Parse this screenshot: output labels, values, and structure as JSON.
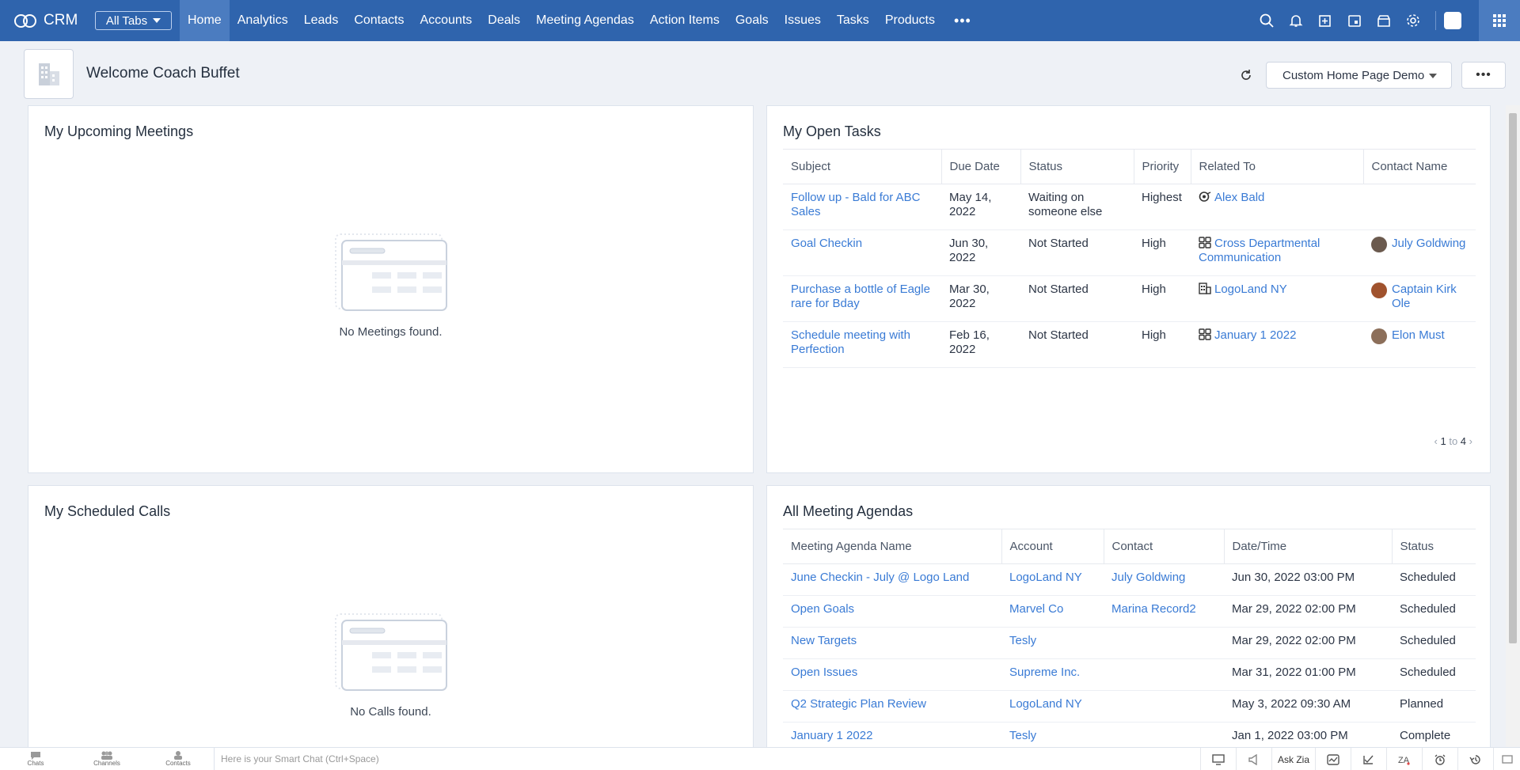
{
  "nav": {
    "brand": "CRM",
    "all_tabs": "All Tabs",
    "links": [
      "Home",
      "Analytics",
      "Leads",
      "Contacts",
      "Accounts",
      "Deals",
      "Meeting Agendas",
      "Action Items",
      "Goals",
      "Issues",
      "Tasks",
      "Products"
    ],
    "active": "Home",
    "more": "•••"
  },
  "header": {
    "welcome": "Welcome Coach Buffet",
    "layout_select": "Custom Home Page Demo",
    "more": "•••"
  },
  "meetings": {
    "title": "My Upcoming Meetings",
    "empty": "No Meetings found."
  },
  "calls": {
    "title": "My Scheduled Calls",
    "empty": "No Calls found."
  },
  "tasks": {
    "title": "My Open Tasks",
    "columns": [
      "Subject",
      "Due Date",
      "Status",
      "Priority",
      "Related To",
      "Contact Name"
    ],
    "rows": [
      {
        "subject": "Follow up - Bald for ABC Sales",
        "due": "May 14, 2022",
        "status": "Waiting on someone else",
        "priority": "Highest",
        "related": "Alex Bald",
        "related_icon": "lead-icon",
        "contact": ""
      },
      {
        "subject": "Goal Checkin",
        "due": "Jun 30, 2022",
        "status": "Not Started",
        "priority": "High",
        "related": "Cross Departmental Communication",
        "related_icon": "module-icon",
        "contact": "July Goldwing"
      },
      {
        "subject": "Purchase a bottle of Eagle rare for Bday",
        "due": "Mar 30, 2022",
        "status": "Not Started",
        "priority": "High",
        "related": "LogoLand NY",
        "related_icon": "account-icon",
        "contact": "Captain Kirk Ole"
      },
      {
        "subject": "Schedule meeting with Perfection",
        "due": "Feb 16, 2022",
        "status": "Not Started",
        "priority": "High",
        "related": "January 1 2022",
        "related_icon": "module-icon",
        "contact": "Elon Must"
      }
    ],
    "pager": {
      "from": "1",
      "to_word": "to",
      "to": "4"
    }
  },
  "agendas": {
    "title": "All Meeting Agendas",
    "columns": [
      "Meeting Agenda Name",
      "Account",
      "Contact",
      "Date/Time",
      "Status"
    ],
    "rows": [
      {
        "name": "June Checkin - July @ Logo Land",
        "account": "LogoLand NY",
        "contact": "July Goldwing",
        "datetime": "Jun 30, 2022 03:00 PM",
        "status": "Scheduled"
      },
      {
        "name": "Open Goals",
        "account": "Marvel Co",
        "contact": "Marina Record2",
        "datetime": "Mar 29, 2022 02:00 PM",
        "status": "Scheduled"
      },
      {
        "name": "New Targets",
        "account": "Tesly",
        "contact": "",
        "datetime": "Mar 29, 2022 02:00 PM",
        "status": "Scheduled"
      },
      {
        "name": "Open Issues",
        "account": "Supreme Inc.",
        "contact": "",
        "datetime": "Mar 31, 2022 01:00 PM",
        "status": "Scheduled"
      },
      {
        "name": "Q2 Strategic Plan Review",
        "account": "LogoLand NY",
        "contact": "",
        "datetime": "May 3, 2022 09:30 AM",
        "status": "Planned"
      },
      {
        "name": "January 1 2022",
        "account": "Tesly",
        "contact": "",
        "datetime": "Jan 1, 2022 03:00 PM",
        "status": "Complete"
      }
    ]
  },
  "bottom": {
    "chats": "Chats",
    "channels": "Channels",
    "contacts": "Contacts",
    "smart_chat": "Here is your Smart Chat (Ctrl+Space)",
    "ask_zia": "Ask Zia"
  },
  "colors": {
    "nav_bg": "#2f64ad",
    "link": "#3a7bd5"
  }
}
